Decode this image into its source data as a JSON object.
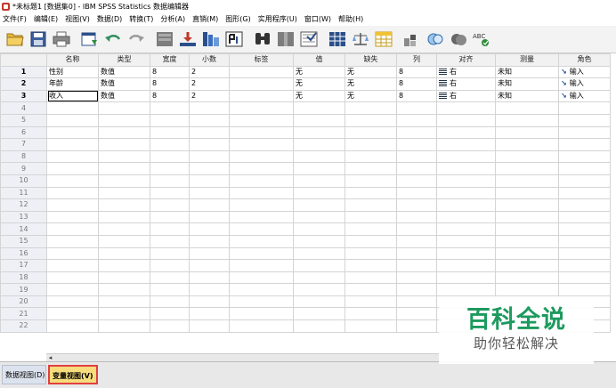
{
  "window": {
    "title": "*未标题1 [数据集0] - IBM SPSS Statistics 数据编辑器"
  },
  "menu": [
    "文件(F)",
    "编辑(E)",
    "视图(V)",
    "数据(D)",
    "转换(T)",
    "分析(A)",
    "直销(M)",
    "图形(G)",
    "实用程序(U)",
    "窗口(W)",
    "帮助(H)"
  ],
  "toolbar": {
    "icons": [
      "open-folder-icon",
      "save-icon",
      "print-icon",
      "dialog-recall-icon",
      "undo-icon",
      "redo-icon",
      "go-to-case-icon",
      "go-to-variable-icon",
      "variables-icon",
      "insert-cases-icon",
      "find-icon",
      "insert-variable-icon",
      "split-file-icon",
      "weight-cases-icon",
      "select-cases-icon",
      "value-labels-icon",
      "use-sets-icon",
      "show-all-variables-icon",
      "spell-check-icon"
    ],
    "spell_label": "ABC"
  },
  "grid": {
    "columns": [
      "名称",
      "类型",
      "宽度",
      "小数",
      "标签",
      "值",
      "缺失",
      "列",
      "对齐",
      "测量",
      "角色"
    ],
    "rows": [
      {
        "num": "1",
        "cells": [
          "性别",
          "数值",
          "8",
          "2",
          "",
          "无",
          "无",
          "8",
          "右",
          "未知",
          "输入"
        ]
      },
      {
        "num": "2",
        "cells": [
          "年龄",
          "数值",
          "8",
          "2",
          "",
          "无",
          "无",
          "8",
          "右",
          "未知",
          "输入"
        ]
      },
      {
        "num": "3",
        "cells": [
          "收入",
          "数值",
          "8",
          "2",
          "",
          "无",
          "无",
          "8",
          "右",
          "未知",
          "输入"
        ]
      }
    ],
    "empty_rows": [
      "4",
      "5",
      "6",
      "7",
      "8",
      "9",
      "10",
      "11",
      "12",
      "13",
      "14",
      "15",
      "16",
      "17",
      "18",
      "19",
      "20",
      "21",
      "22"
    ]
  },
  "tabs": {
    "data_view": "数据视图(D)",
    "variable_view": "变量视图(V)"
  },
  "watermark": {
    "title": "百科全说",
    "subtitle": "助你轻松解决"
  },
  "colors": {
    "accent_tab": "#f6dc7c",
    "highlight_border": "#e04040",
    "watermark_green": "#1d9a5e"
  }
}
